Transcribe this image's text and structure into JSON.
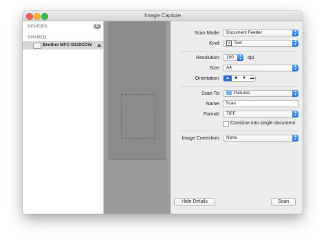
{
  "window": {
    "title": "Image Capture"
  },
  "sidebar": {
    "devices_header": "DEVICES",
    "devices_count": "0",
    "shared_header": "SHARED",
    "shared_items": [
      {
        "label": "Brother MFC-9330CDW",
        "eject_icon": "⏏"
      }
    ]
  },
  "settings": {
    "scan_mode": {
      "label": "Scan Mode:",
      "value": "Document Feeder"
    },
    "kind": {
      "label": "Kind:",
      "value": "Text",
      "icon": "A"
    },
    "resolution": {
      "label": "Resolution:",
      "value": "100",
      "unit": "dpi"
    },
    "size": {
      "label": "Size:",
      "value": "A4"
    },
    "orientation": {
      "label": "Orientation:",
      "options": [
        "▲",
        "■",
        "▼",
        "▬"
      ],
      "selected_index": 0
    },
    "scan_to": {
      "label": "Scan To:",
      "value": "Pictures"
    },
    "name": {
      "label": "Name:",
      "value": "Scan"
    },
    "format": {
      "label": "Format:",
      "value": "TIFF"
    },
    "combine": {
      "label": "Combine into single document",
      "checked": false
    },
    "image_correction": {
      "label": "Image Correction:",
      "value": "None"
    }
  },
  "buttons": {
    "hide_details": "Hide Details",
    "scan": "Scan"
  },
  "colors": {
    "accent": "#1f6fe5",
    "preview_bg": "#9a9c9d",
    "sidebar_selected": "#d6d6d6"
  }
}
